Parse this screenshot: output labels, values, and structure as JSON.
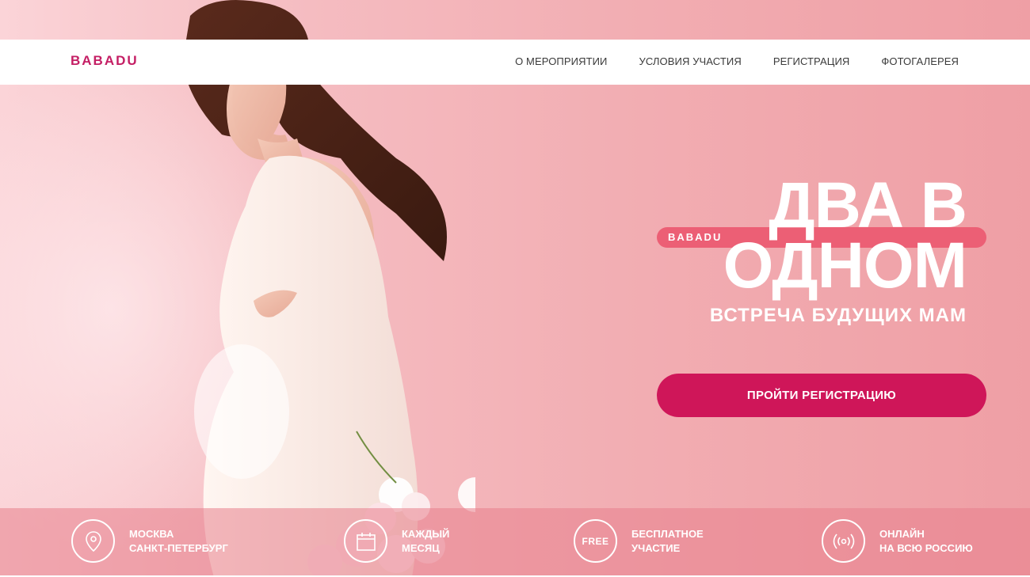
{
  "header": {
    "logo": "BABADU",
    "nav": [
      "О МЕРОПРИЯТИИ",
      "УСЛОВИЯ УЧАСТИЯ",
      "РЕГИСТРАЦИЯ",
      "ФОТОГАЛЕРЕЯ"
    ]
  },
  "hero": {
    "brand_pill_logo": "BABADU",
    "title_line1": "ДВА В",
    "title_line2": "ОДНОМ",
    "subtitle": "ВСТРЕЧА БУДУЩИХ МАМ",
    "cta_label": "ПРОЙТИ РЕГИСТРАЦИЮ"
  },
  "features": [
    {
      "icon": "location-pin-icon",
      "line1": "МОСКВА",
      "line2": "САНКТ-ПЕТЕРБУРГ"
    },
    {
      "icon": "calendar-icon",
      "line1": "КАЖДЫЙ",
      "line2": "МЕСЯЦ"
    },
    {
      "icon": "free-badge-icon",
      "badge": "FREE",
      "line1": "БЕСПЛАТНОЕ",
      "line2": "УЧАСТИЕ"
    },
    {
      "icon": "broadcast-icon",
      "line1": "ОНЛАЙН",
      "line2": "НА ВСЮ РОССИЮ"
    }
  ],
  "colors": {
    "brand": "#c41e64",
    "cta": "#cf1659",
    "pill": "#ec5f75",
    "background": "#f2aeb3"
  }
}
